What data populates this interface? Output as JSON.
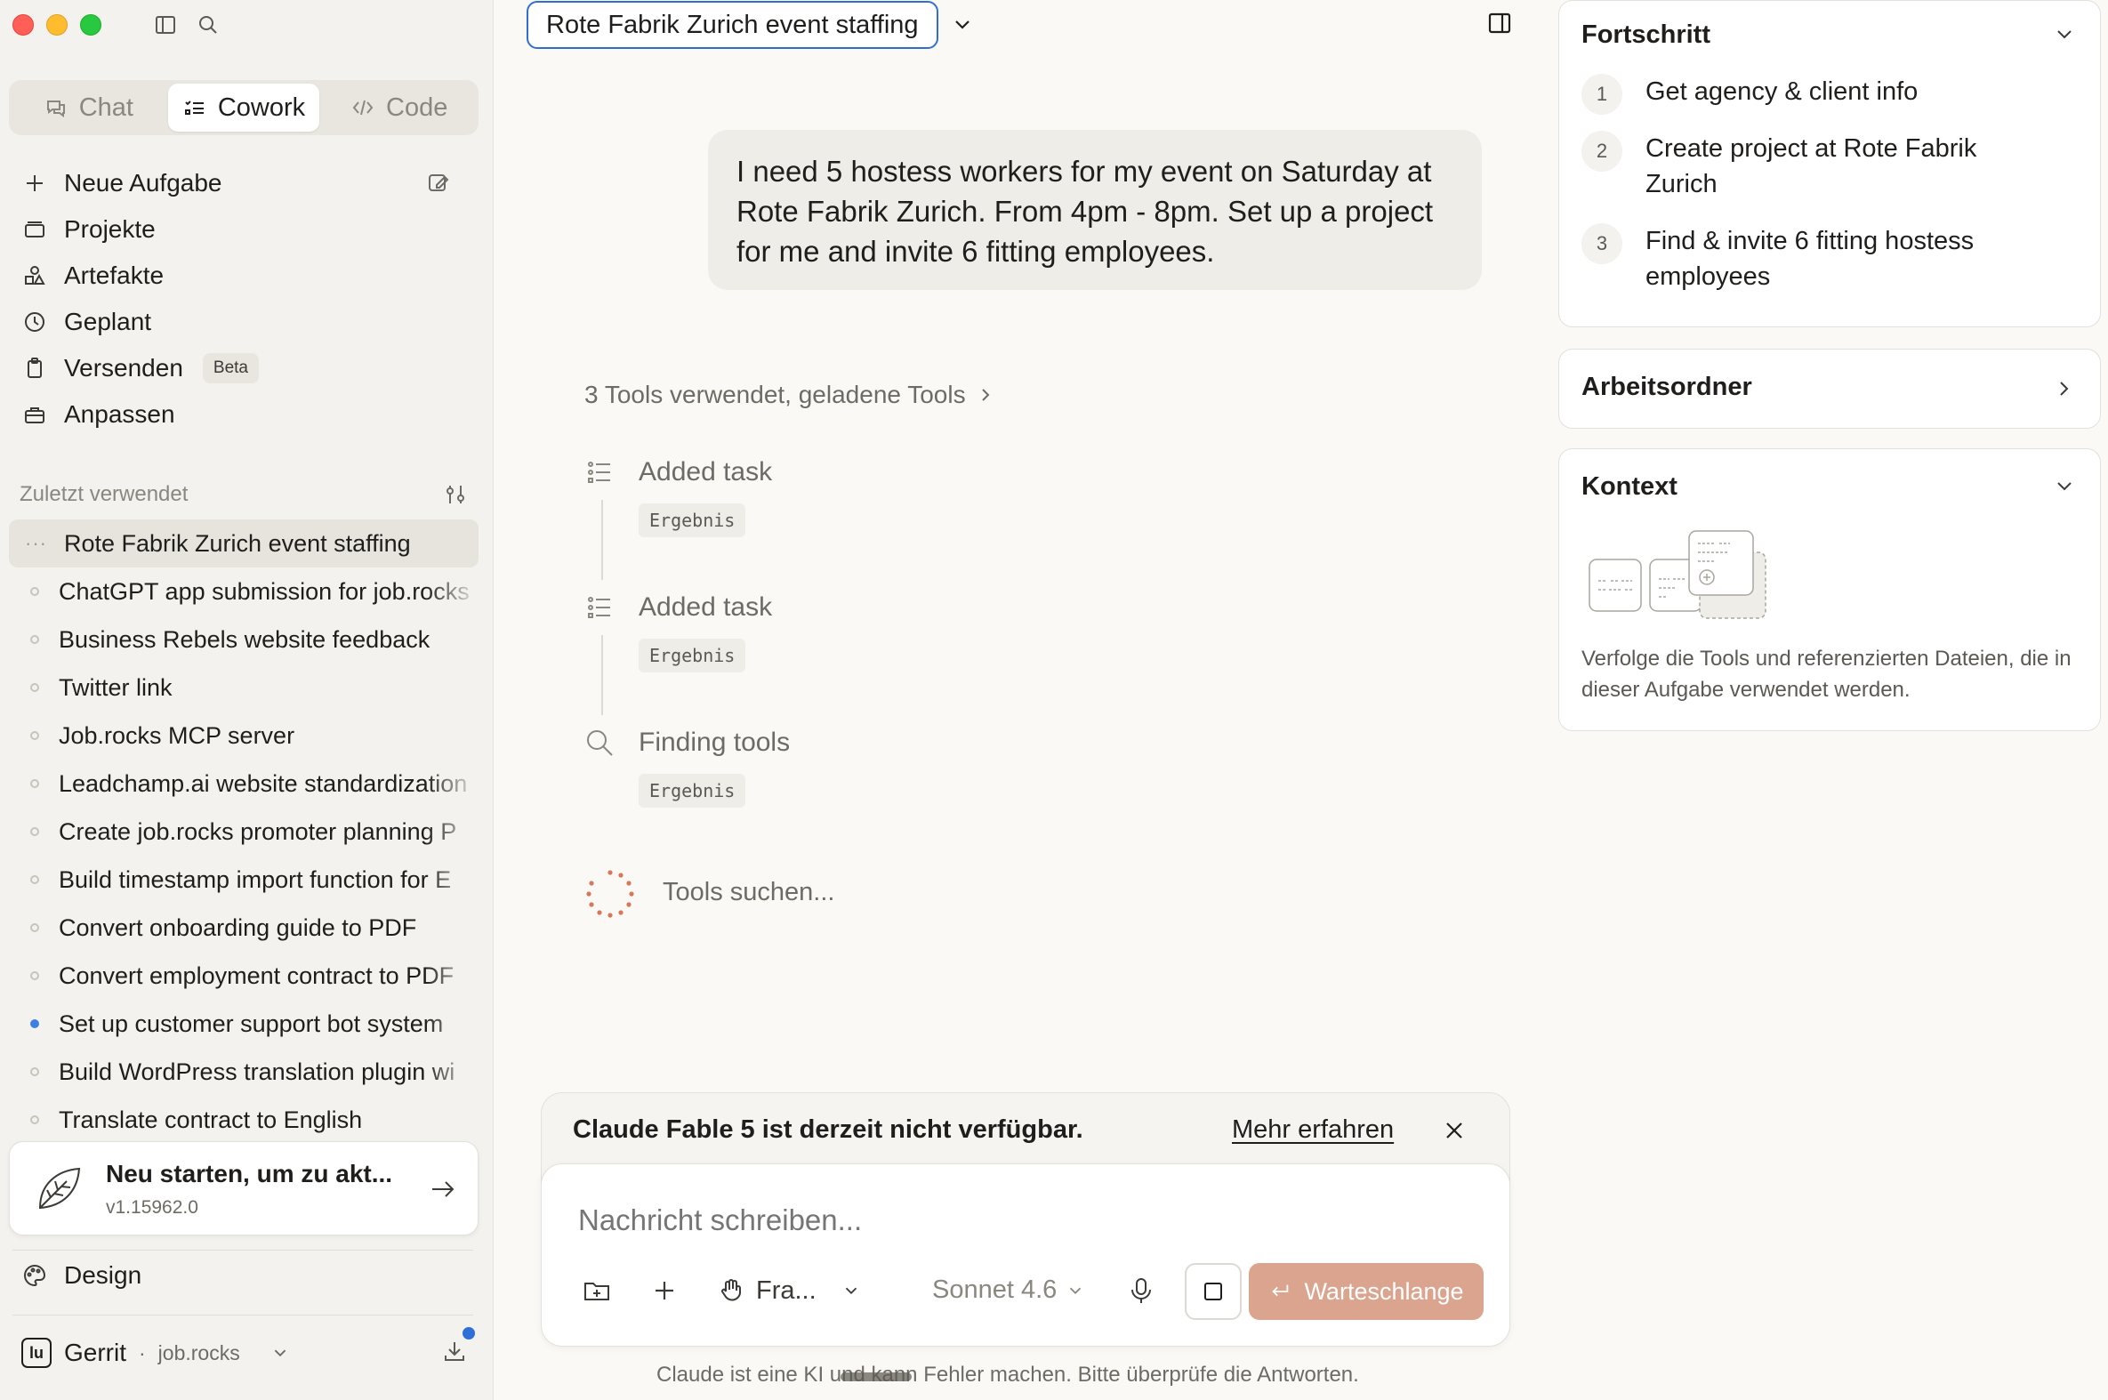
{
  "sidebar": {
    "modes": [
      {
        "label": "Chat",
        "icon": "chat-bubbles-icon"
      },
      {
        "label": "Cowork",
        "icon": "checklist-icon"
      },
      {
        "label": "Code",
        "icon": "code-icon"
      }
    ],
    "nav": [
      {
        "label": "Neue Aufgabe",
        "icon": "plus-icon"
      },
      {
        "label": "Projekte",
        "icon": "folder-icon"
      },
      {
        "label": "Artefakte",
        "icon": "artifacts-icon"
      },
      {
        "label": "Geplant",
        "icon": "clock-icon"
      },
      {
        "label": "Versenden",
        "icon": "clipboard-icon",
        "badge": "Beta"
      },
      {
        "label": "Anpassen",
        "icon": "toolbox-icon"
      }
    ],
    "recent_header": "Zuletzt verwendet",
    "recent": [
      "Rote Fabrik Zurich event staffing",
      "ChatGPT app submission for job.rocks",
      "Business Rebels website feedback",
      "Twitter link",
      "Job.rocks MCP server",
      "Leadchamp.ai website standardization",
      "Create job.rocks promoter planning P",
      "Build timestamp import function for E",
      "Convert onboarding guide to PDF",
      "Convert employment contract to PDF",
      "Set up customer support bot system",
      "Build WordPress translation plugin wi",
      "Translate contract to English"
    ],
    "update": {
      "title": "Neu starten, um zu akt...",
      "version": "v1.15962.0"
    },
    "design": "Design",
    "user": {
      "name": "Gerrit",
      "separator": "·",
      "org": "job.rocks",
      "logo": "lu"
    }
  },
  "main": {
    "title": "Rote Fabrik Zurich event staffing",
    "user_message": "I need 5 hostess workers for my event on Saturday at Rote Fabrik Zurich. From 4pm - 8pm. Set up a project for me and invite 6 fitting employees.",
    "tools_summary": "3 Tools verwendet, geladene Tools",
    "tool_steps": [
      {
        "label": "Added task",
        "result": "Ergebnis",
        "icon": "list-icon"
      },
      {
        "label": "Added task",
        "result": "Ergebnis",
        "icon": "list-icon"
      },
      {
        "label": "Finding tools",
        "result": "Ergebnis",
        "icon": "search-icon"
      }
    ],
    "searching": "Tools suchen...",
    "notice": {
      "text": "Claude Fable 5 ist derzeit nicht verfügbar.",
      "link": "Mehr erfahren"
    },
    "composer": {
      "placeholder": "Nachricht schreiben...",
      "style_label": "Fra...",
      "model_label": "Sonnet 4.6",
      "queue_label": "Warteschlange"
    },
    "footer": "Claude ist eine KI und kann Fehler machen. Bitte überprüfe die Antworten."
  },
  "right_panel": {
    "progress_title": "Fortschritt",
    "steps": [
      {
        "num": "1",
        "text": "Get agency & client info"
      },
      {
        "num": "2",
        "text": "Create project at Rote Fabrik Zurich"
      },
      {
        "num": "3",
        "text": "Find & invite 6 fitting hostess employees"
      }
    ],
    "folder_title": "Arbeitsordner",
    "context_title": "Kontext",
    "context_desc": "Verfolge die Tools und referenzierten Dateien, die in dieser Aufgabe verwendet werden."
  },
  "colors": {
    "accent_blue": "#2f6fd0",
    "queue_button": "#dba48e",
    "spinner": "#d97757"
  }
}
